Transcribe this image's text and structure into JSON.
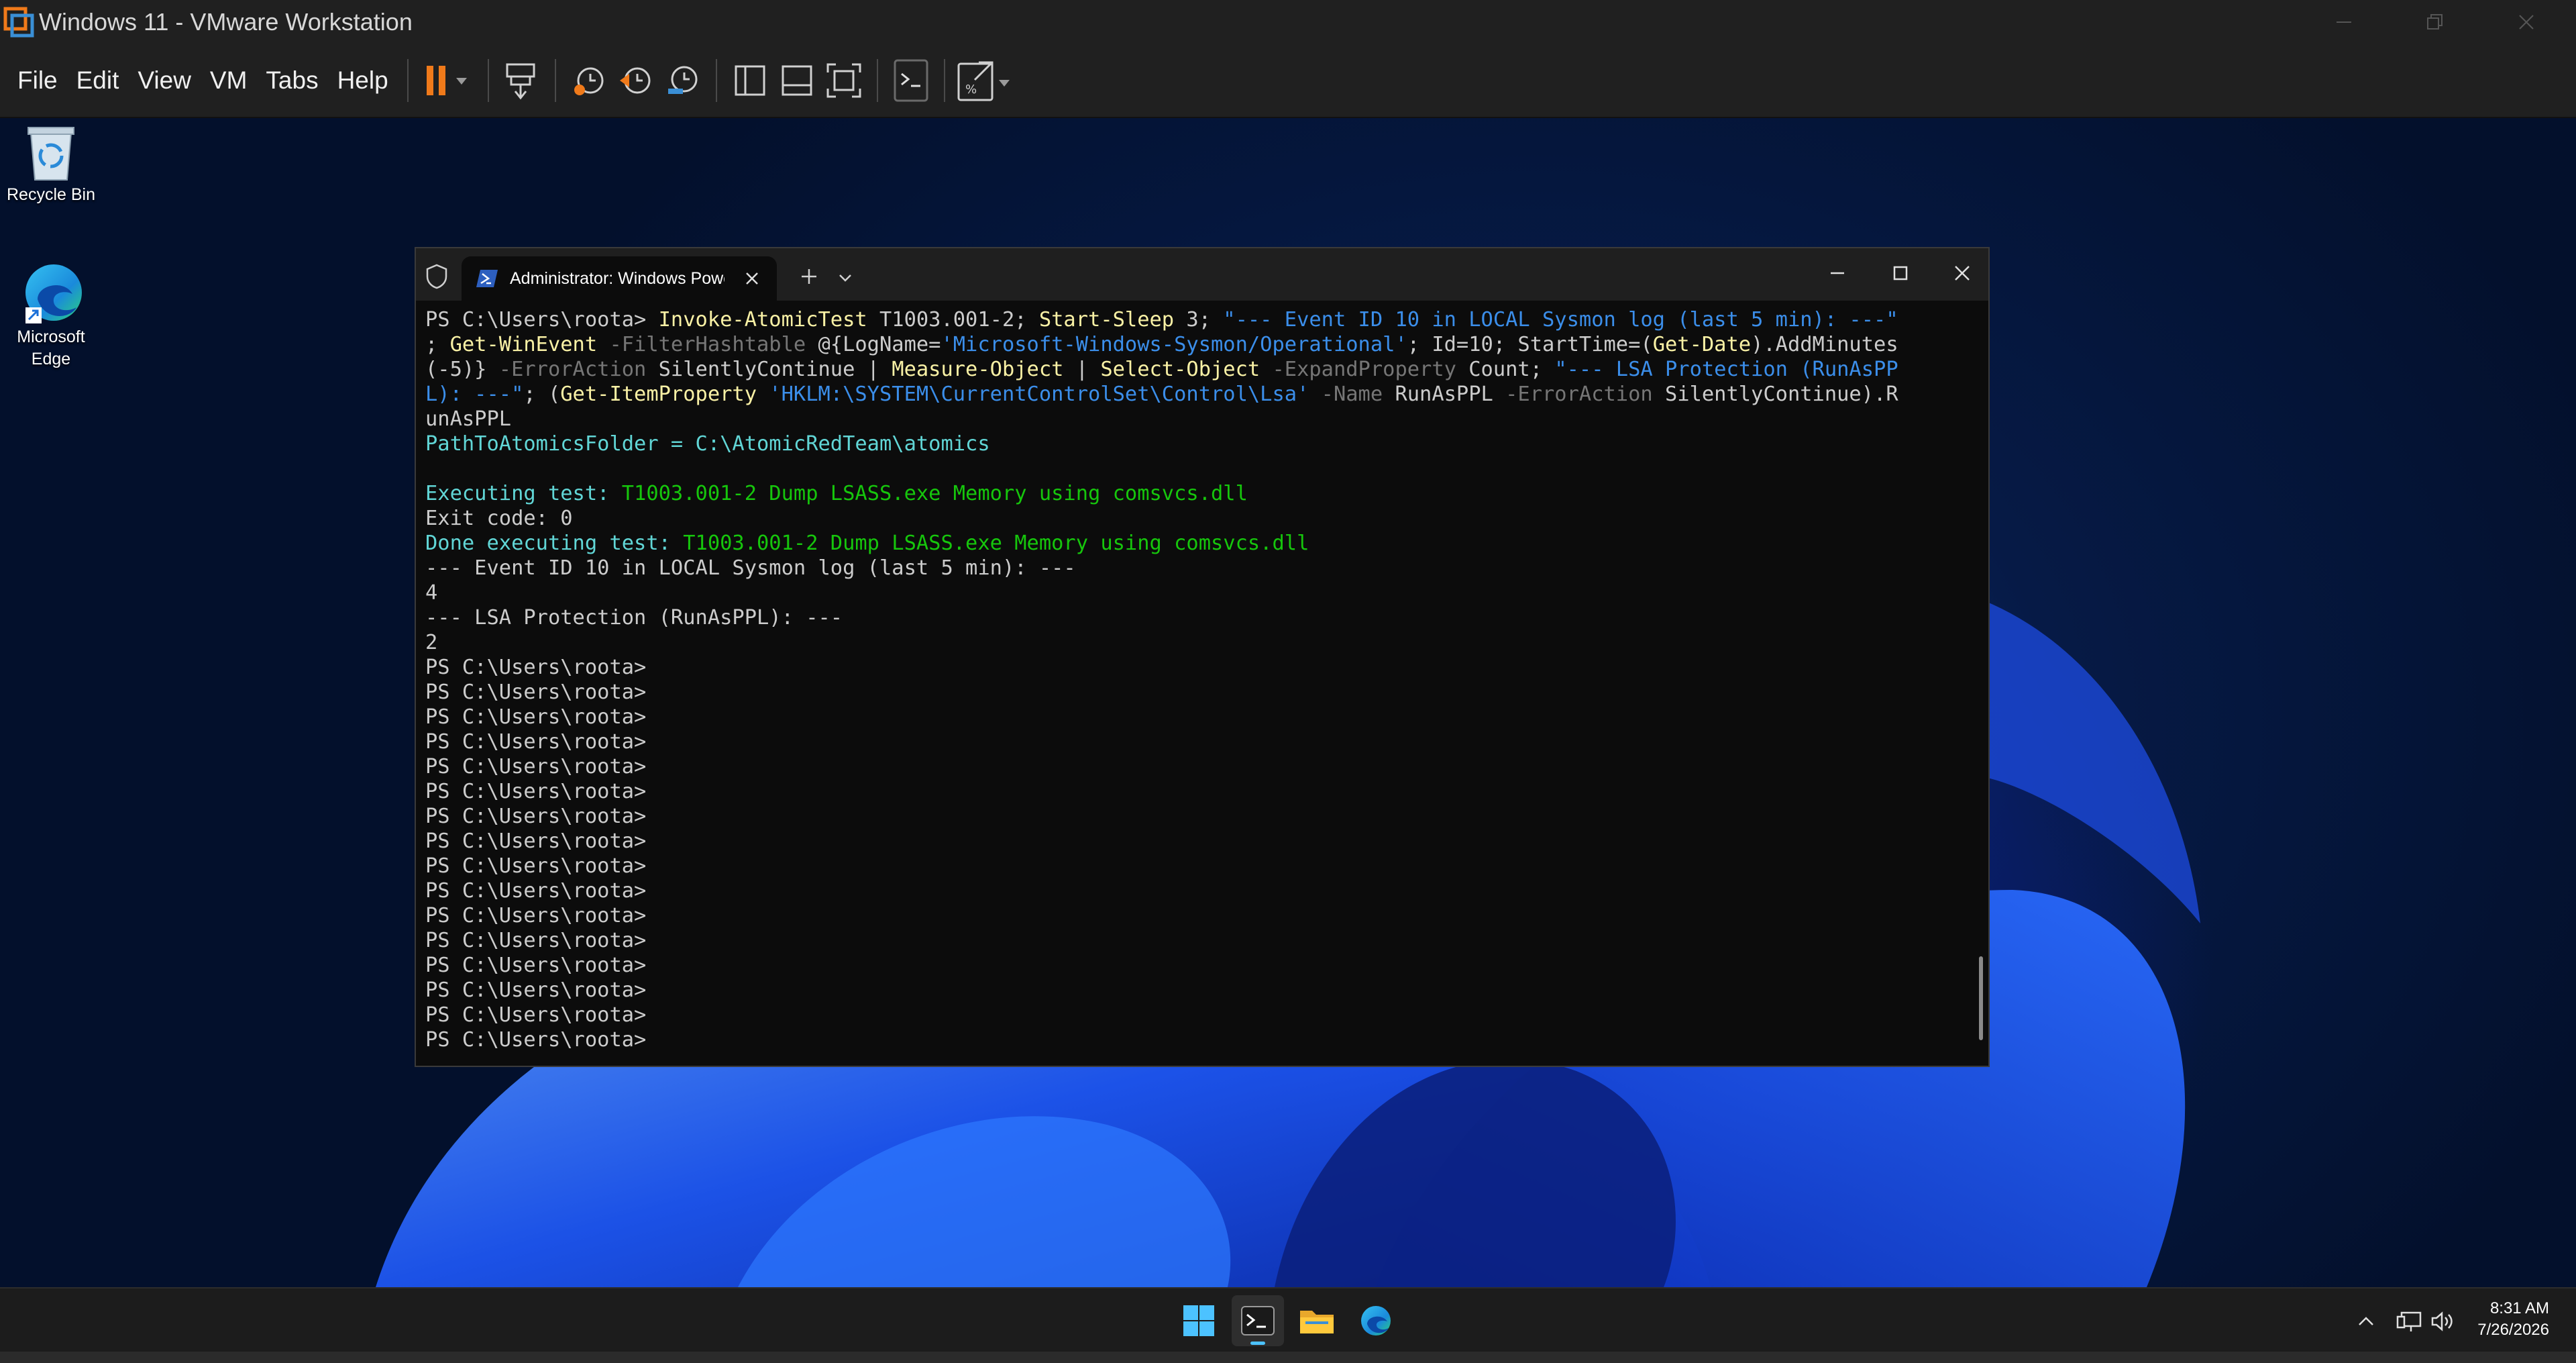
{
  "window": {
    "title": "Windows 11 - VMware Workstation"
  },
  "menu": [
    "File",
    "Edit",
    "View",
    "VM",
    "Tabs",
    "Help"
  ],
  "desktop_icons": [
    {
      "label": "Recycle Bin",
      "icon": "recycle-bin-icon"
    },
    {
      "label_lines": [
        "Microsoft",
        "Edge"
      ],
      "icon": "edge-icon"
    }
  ],
  "terminal": {
    "tab_title": "Administrator: Windows PowerShell",
    "lines": [
      [
        [
          "PS C:\\Users\\roota> ",
          ""
        ],
        [
          "Invoke-AtomicTest",
          "y"
        ],
        [
          " T1003.001-2; ",
          ""
        ],
        [
          "Start-Sleep",
          "y"
        ],
        [
          " 3; ",
          ""
        ],
        [
          "\"--- Event ID 10 in LOCAL Sysmon log (last 5 min): ---\"",
          "b"
        ]
      ],
      [
        [
          "; ",
          ""
        ],
        [
          "Get-WinEvent",
          "y"
        ],
        [
          " -FilterHashtable",
          "g"
        ],
        [
          " @{LogName=",
          ""
        ],
        [
          "'Microsoft-Windows-Sysmon/Operational'",
          "b"
        ],
        [
          "; Id=10; StartTime=(",
          ""
        ],
        [
          "Get-Date",
          "y"
        ],
        [
          ").AddMinutes",
          ""
        ]
      ],
      [
        [
          "(-5)} ",
          ""
        ],
        [
          "-ErrorAction",
          "g"
        ],
        [
          " SilentlyContinue | ",
          ""
        ],
        [
          "Measure-Object",
          "y"
        ],
        [
          " | ",
          ""
        ],
        [
          "Select-Object",
          "y"
        ],
        [
          " -ExpandProperty",
          "g"
        ],
        [
          " Count; ",
          ""
        ],
        [
          "\"--- LSA Protection (RunAsPP",
          "b"
        ]
      ],
      [
        [
          "L): ---\"",
          "b"
        ],
        [
          "; (",
          ""
        ],
        [
          "Get-ItemProperty",
          "y"
        ],
        [
          " 'HKLM:\\SYSTEM\\CurrentControlSet\\Control\\Lsa'",
          "b"
        ],
        [
          " -Name",
          "g"
        ],
        [
          " RunAsPPL ",
          ""
        ],
        [
          "-ErrorAction",
          "g"
        ],
        [
          " SilentlyContinue).R",
          ""
        ]
      ],
      [
        [
          "unAsPPL",
          ""
        ]
      ],
      [
        [
          "PathToAtomicsFolder = C:\\AtomicRedTeam\\atomics",
          "c"
        ]
      ],
      [
        [
          "",
          ""
        ]
      ],
      [
        [
          "Executing test: ",
          "c"
        ],
        [
          "T1003.001-2 Dump LSASS.exe Memory using comsvcs.dll",
          "gr"
        ]
      ],
      [
        [
          "Exit code: 0",
          ""
        ]
      ],
      [
        [
          "Done executing test: ",
          "c"
        ],
        [
          "T1003.001-2 Dump LSASS.exe Memory using comsvcs.dll",
          "gr"
        ]
      ],
      [
        [
          "--- Event ID 10 in LOCAL Sysmon log (last 5 min): ---",
          ""
        ]
      ],
      [
        [
          "4",
          ""
        ]
      ],
      [
        [
          "--- LSA Protection (RunAsPPL): ---",
          ""
        ]
      ],
      [
        [
          "2",
          ""
        ]
      ],
      [
        [
          "PS C:\\Users\\roota>",
          ""
        ]
      ],
      [
        [
          "PS C:\\Users\\roota>",
          ""
        ]
      ],
      [
        [
          "PS C:\\Users\\roota>",
          ""
        ]
      ],
      [
        [
          "PS C:\\Users\\roota>",
          ""
        ]
      ],
      [
        [
          "PS C:\\Users\\roota>",
          ""
        ]
      ],
      [
        [
          "PS C:\\Users\\roota>",
          ""
        ]
      ],
      [
        [
          "PS C:\\Users\\roota>",
          ""
        ]
      ],
      [
        [
          "PS C:\\Users\\roota>",
          ""
        ]
      ],
      [
        [
          "PS C:\\Users\\roota>",
          ""
        ]
      ],
      [
        [
          "PS C:\\Users\\roota>",
          ""
        ]
      ],
      [
        [
          "PS C:\\Users\\roota>",
          ""
        ]
      ],
      [
        [
          "PS C:\\Users\\roota>",
          ""
        ]
      ],
      [
        [
          "PS C:\\Users\\roota>",
          ""
        ]
      ],
      [
        [
          "PS C:\\Users\\roota>",
          ""
        ]
      ],
      [
        [
          "PS C:\\Users\\roota>",
          ""
        ]
      ],
      [
        [
          "PS C:\\Users\\roota>",
          ""
        ]
      ]
    ]
  },
  "taskbar": {
    "apps": [
      "start-icon",
      "terminal-icon",
      "file-explorer-icon",
      "edge-icon"
    ],
    "time": "8:31 AM",
    "date": "7/26/2026"
  },
  "colors": {
    "accent_orange": "#f07a1a",
    "ps_yellow": "#f9f1a5",
    "ps_blue": "#3b8eea",
    "ps_cyan": "#61d6d6",
    "ps_green": "#16c60c"
  }
}
